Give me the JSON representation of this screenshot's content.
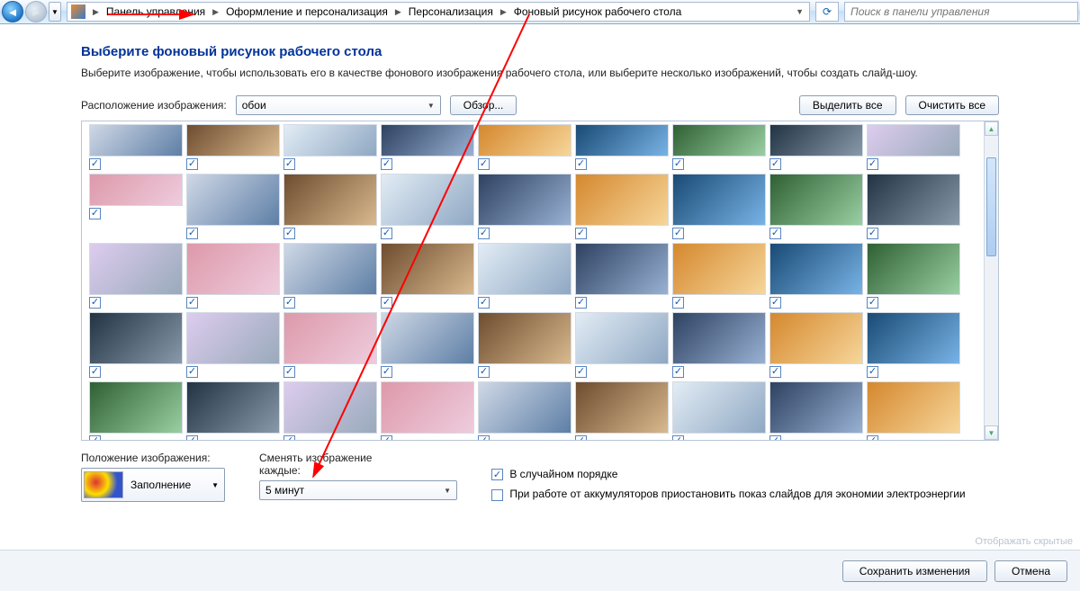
{
  "breadcrumbs": [
    "Панель управления",
    "Оформление и персонализация",
    "Персонализация",
    "Фоновый рисунок рабочего стола"
  ],
  "search_placeholder": "Поиск в панели управления",
  "heading": "Выберите фоновый рисунок рабочего стола",
  "subtitle": "Выберите изображение, чтобы использовать его в качестве фонового изображения рабочего стола, или выберите несколько изображений, чтобы создать слайд-шоу.",
  "image_location_label": "Расположение изображения:",
  "image_location_value": "обои",
  "browse_label": "Обзор...",
  "select_all_label": "Выделить все",
  "clear_all_label": "Очистить все",
  "position_label": "Положение изображения:",
  "position_value": "Заполнение",
  "interval_label_l1": "Сменять изображение",
  "interval_label_l2": "каждые:",
  "interval_value": "5 минут",
  "shuffle_label": "В случайном порядке",
  "shuffle_checked": true,
  "battery_label": "При работе от аккумуляторов приостановить показ слайдов для экономии электроэнергии",
  "battery_checked": false,
  "save_label": "Сохранить изменения",
  "cancel_label": "Отмена",
  "status_hint": "Отображать скрытые",
  "thumb_count_half_top": 10,
  "thumb_rows_full": 4,
  "thumb_count_half_bottom": 10
}
